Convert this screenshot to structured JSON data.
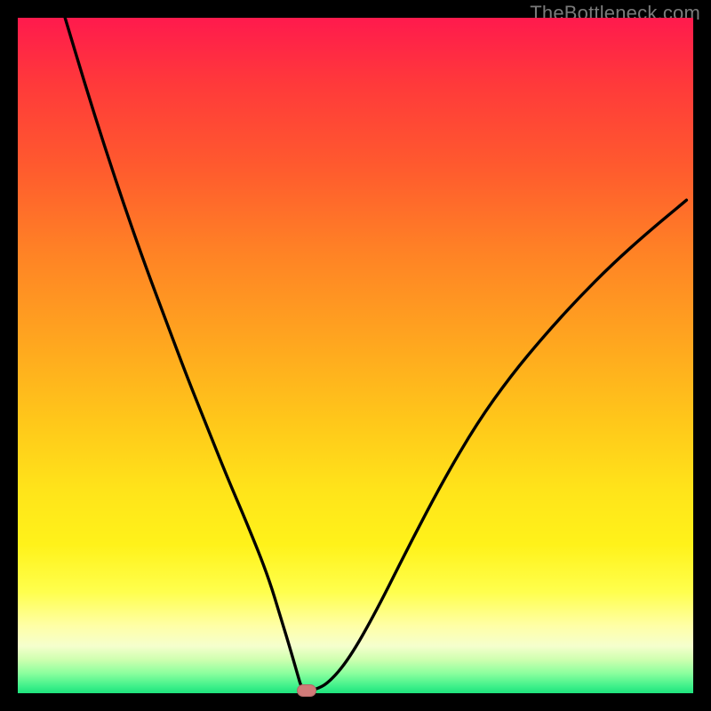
{
  "watermark": "TheBottleneck.com",
  "colors": {
    "frame": "#000000",
    "curve": "#000000",
    "marker": "#d07a78",
    "watermark_text": "#7a7a7a",
    "gradient_top": "#ff1a4d",
    "gradient_bottom": "#1ee37d"
  },
  "chart_data": {
    "type": "line",
    "title": "",
    "xlabel": "",
    "ylabel": "",
    "xlim": [
      0,
      100
    ],
    "ylim": [
      0,
      100
    ],
    "grid": false,
    "legend": false,
    "series": [
      {
        "name": "bottleneck-curve",
        "x": [
          7,
          10,
          13,
          16,
          19,
          22,
          25,
          28,
          31,
          34,
          37,
          39,
          40.5,
          41.5,
          42,
          43,
          44,
          46,
          49,
          53,
          58,
          63,
          68,
          73,
          78,
          83,
          88,
          93,
          99
        ],
        "y": [
          100,
          90,
          80.5,
          71.5,
          63,
          55,
          47,
          39.5,
          32,
          25,
          17.5,
          11,
          6,
          2.5,
          0.8,
          0.5,
          0.5,
          1.5,
          5,
          12,
          22,
          31.5,
          40,
          47,
          53,
          58.5,
          63.5,
          68,
          73
        ]
      }
    ],
    "marker": {
      "x": 42.7,
      "y": 0.4
    }
  }
}
